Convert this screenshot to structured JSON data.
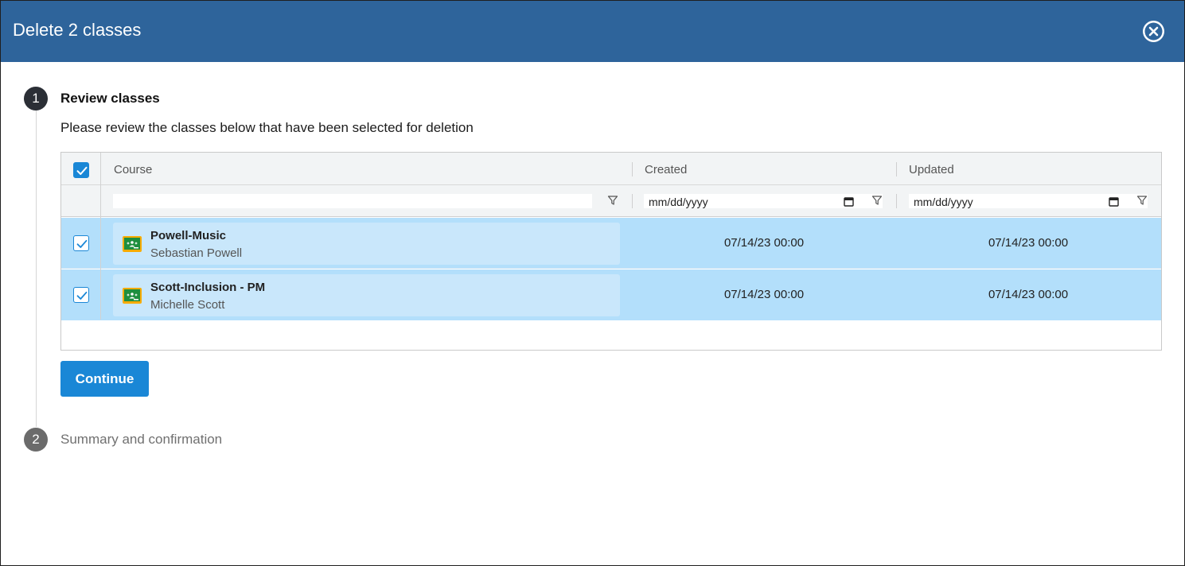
{
  "dialog": {
    "title": "Delete 2 classes",
    "close_icon": "close-circle-icon"
  },
  "steps": [
    {
      "number": "1",
      "title": "Review classes",
      "description": "Please review the classes below that have been selected for deletion"
    },
    {
      "number": "2",
      "title": "Summary and confirmation"
    }
  ],
  "table": {
    "select_all_checked": true,
    "columns": [
      "Course",
      "Created",
      "Updated"
    ],
    "filters": {
      "course_value": "",
      "created_placeholder": "mm/dd/yyyy",
      "updated_placeholder": "mm/dd/yyyy"
    },
    "rows": [
      {
        "checked": true,
        "course": "Powell-Music",
        "teacher": "Sebastian Powell",
        "created": "07/14/23 00:00",
        "updated": "07/14/23 00:00"
      },
      {
        "checked": true,
        "course": "Scott-Inclusion - PM",
        "teacher": "Michelle Scott",
        "created": "07/14/23 00:00",
        "updated": "07/14/23 00:00"
      }
    ]
  },
  "continue_label": "Continue",
  "colors": {
    "header_bg": "#2e649b",
    "accent": "#1a87d6",
    "row_selected": "#b3dffb",
    "classroom_green": "#1e8e3e",
    "classroom_yellow": "#f9ab00"
  }
}
